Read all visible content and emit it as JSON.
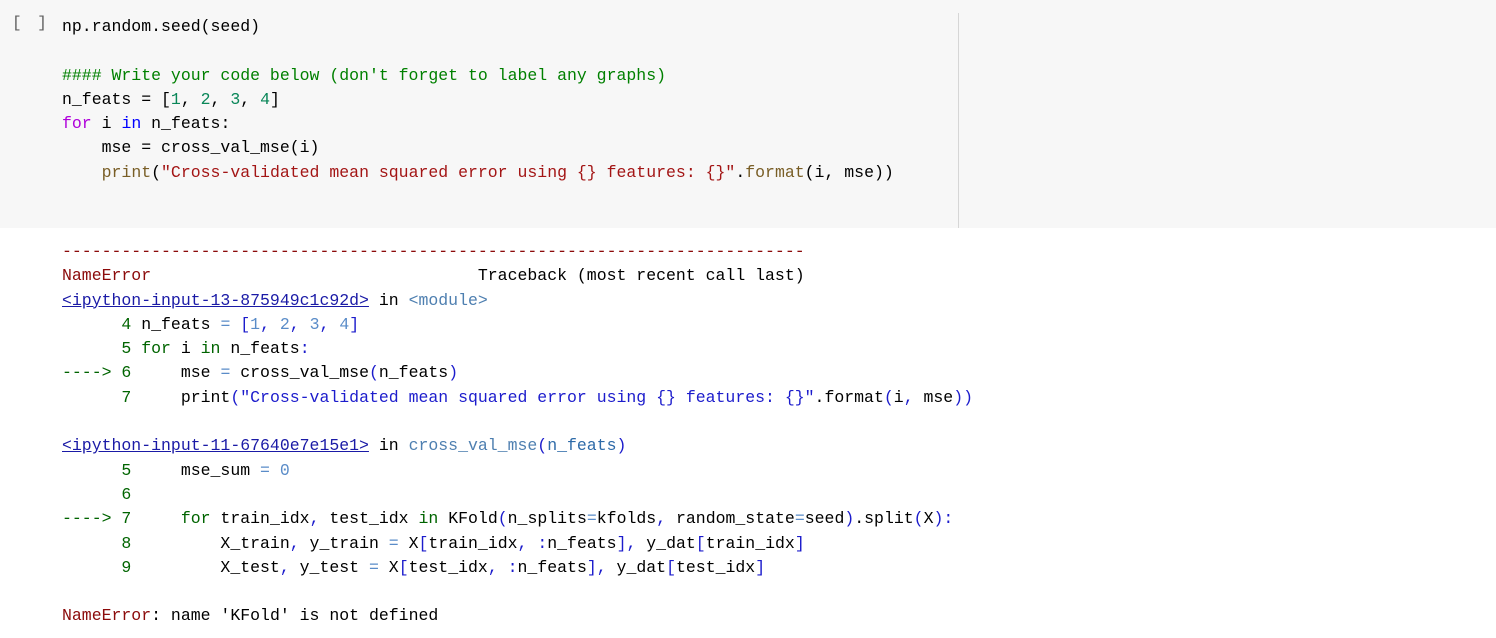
{
  "cell": {
    "execution_count": "[ ]",
    "code_lines": [
      [
        {
          "t": "np.random.seed(seed)",
          "c": ""
        }
      ],
      [
        {
          "t": "",
          "c": ""
        }
      ],
      [
        {
          "t": "#### Write your code below (don't forget to label any graphs)",
          "c": "c-comment"
        }
      ],
      [
        {
          "t": "n_feats = [",
          "c": ""
        },
        {
          "t": "1",
          "c": "c-num"
        },
        {
          "t": ", ",
          "c": ""
        },
        {
          "t": "2",
          "c": "c-num"
        },
        {
          "t": ", ",
          "c": ""
        },
        {
          "t": "3",
          "c": "c-num"
        },
        {
          "t": ", ",
          "c": ""
        },
        {
          "t": "4",
          "c": "c-num"
        },
        {
          "t": "]",
          "c": ""
        }
      ],
      [
        {
          "t": "for",
          "c": "c-kw"
        },
        {
          "t": " i ",
          "c": ""
        },
        {
          "t": "in",
          "c": "c-kw2"
        },
        {
          "t": " n_feats:",
          "c": ""
        }
      ],
      [
        {
          "t": "    mse = cross_val_mse(i)",
          "c": ""
        }
      ],
      [
        {
          "t": "    ",
          "c": ""
        },
        {
          "t": "print",
          "c": "c-fn"
        },
        {
          "t": "(",
          "c": ""
        },
        {
          "t": "\"Cross-validated mean squared error using {} features: {}\"",
          "c": "c-str"
        },
        {
          "t": ".",
          "c": ""
        },
        {
          "t": "format",
          "c": "c-fn"
        },
        {
          "t": "(i, mse))",
          "c": ""
        }
      ]
    ]
  },
  "output": {
    "lines": [
      [
        {
          "t": "---------------------------------------------------------------------------",
          "c": "t-red"
        }
      ],
      [
        {
          "t": "NameError",
          "c": "t-red"
        },
        {
          "t": "                                 Traceback (most recent call last)",
          "c": ""
        }
      ],
      [
        {
          "t": "<ipython-input-13-875949c1c92d>",
          "c": "t-link"
        },
        {
          "t": " in ",
          "c": ""
        },
        {
          "t": "<module>",
          "c": "t-gray-blue"
        }
      ],
      [
        {
          "t": "      4",
          "c": "t-green"
        },
        {
          "t": " n_feats ",
          "c": ""
        },
        {
          "t": "=",
          "c": "t-dim"
        },
        {
          "t": " ",
          "c": ""
        },
        {
          "t": "[",
          "c": "t-blue"
        },
        {
          "t": "1",
          "c": "t-dim"
        },
        {
          "t": ",",
          "c": "t-blue"
        },
        {
          "t": " ",
          "c": ""
        },
        {
          "t": "2",
          "c": "t-dim"
        },
        {
          "t": ",",
          "c": "t-blue"
        },
        {
          "t": " ",
          "c": ""
        },
        {
          "t": "3",
          "c": "t-dim"
        },
        {
          "t": ",",
          "c": "t-blue"
        },
        {
          "t": " ",
          "c": ""
        },
        {
          "t": "4",
          "c": "t-dim"
        },
        {
          "t": "]",
          "c": "t-blue"
        }
      ],
      [
        {
          "t": "      5",
          "c": "t-green"
        },
        {
          "t": " ",
          "c": ""
        },
        {
          "t": "for",
          "c": "t-green"
        },
        {
          "t": " i ",
          "c": ""
        },
        {
          "t": "in",
          "c": "t-green"
        },
        {
          "t": " n_feats",
          "c": ""
        },
        {
          "t": ":",
          "c": "t-blue"
        }
      ],
      [
        {
          "t": "----> 6",
          "c": "t-green"
        },
        {
          "t": "     mse ",
          "c": ""
        },
        {
          "t": "=",
          "c": "t-dim"
        },
        {
          "t": " cross_val_mse",
          "c": ""
        },
        {
          "t": "(",
          "c": "t-blue"
        },
        {
          "t": "n_feats",
          "c": ""
        },
        {
          "t": ")",
          "c": "t-blue"
        }
      ],
      [
        {
          "t": "      7",
          "c": "t-green"
        },
        {
          "t": "     print",
          "c": ""
        },
        {
          "t": "(\"Cross-validated mean squared error using {} features: {}\"",
          "c": "t-blue"
        },
        {
          "t": ".",
          "c": ""
        },
        {
          "t": "format",
          "c": ""
        },
        {
          "t": "(",
          "c": "t-blue"
        },
        {
          "t": "i",
          "c": ""
        },
        {
          "t": ",",
          "c": "t-blue"
        },
        {
          "t": " mse",
          "c": ""
        },
        {
          "t": "))",
          "c": "t-blue"
        }
      ],
      [
        {
          "t": "",
          "c": ""
        }
      ],
      [
        {
          "t": "<ipython-input-11-67640e7e15e1>",
          "c": "t-link"
        },
        {
          "t": " in ",
          "c": ""
        },
        {
          "t": "cross_val_mse",
          "c": "t-gray-blue"
        },
        {
          "t": "(",
          "c": "t-blue"
        },
        {
          "t": "n_feats",
          "c": "t-teal"
        },
        {
          "t": ")",
          "c": "t-blue"
        }
      ],
      [
        {
          "t": "      5",
          "c": "t-green"
        },
        {
          "t": "     mse_sum ",
          "c": ""
        },
        {
          "t": "=",
          "c": "t-dim"
        },
        {
          "t": " ",
          "c": ""
        },
        {
          "t": "0",
          "c": "t-dim"
        }
      ],
      [
        {
          "t": "      6",
          "c": "t-green"
        }
      ],
      [
        {
          "t": "----> 7",
          "c": "t-green"
        },
        {
          "t": "     for",
          "c": "t-green"
        },
        {
          "t": " train_idx",
          "c": ""
        },
        {
          "t": ",",
          "c": "t-blue"
        },
        {
          "t": " test_idx ",
          "c": ""
        },
        {
          "t": "in",
          "c": "t-green"
        },
        {
          "t": " KFold",
          "c": ""
        },
        {
          "t": "(",
          "c": "t-blue"
        },
        {
          "t": "n_splits",
          "c": ""
        },
        {
          "t": "=",
          "c": "t-dim"
        },
        {
          "t": "kfolds",
          "c": ""
        },
        {
          "t": ",",
          "c": "t-blue"
        },
        {
          "t": " random_state",
          "c": ""
        },
        {
          "t": "=",
          "c": "t-dim"
        },
        {
          "t": "seed",
          "c": ""
        },
        {
          "t": ")",
          "c": "t-blue"
        },
        {
          "t": ".",
          "c": ""
        },
        {
          "t": "split",
          "c": ""
        },
        {
          "t": "(",
          "c": "t-blue"
        },
        {
          "t": "X",
          "c": ""
        },
        {
          "t": "):",
          "c": "t-blue"
        }
      ],
      [
        {
          "t": "      8",
          "c": "t-green"
        },
        {
          "t": "         X_train",
          "c": ""
        },
        {
          "t": ",",
          "c": "t-blue"
        },
        {
          "t": " y_train ",
          "c": ""
        },
        {
          "t": "=",
          "c": "t-dim"
        },
        {
          "t": " X",
          "c": ""
        },
        {
          "t": "[",
          "c": "t-blue"
        },
        {
          "t": "train_idx",
          "c": ""
        },
        {
          "t": ",",
          "c": "t-blue"
        },
        {
          "t": " ",
          "c": ""
        },
        {
          "t": ":",
          "c": "t-blue"
        },
        {
          "t": "n_feats",
          "c": ""
        },
        {
          "t": "],",
          "c": "t-blue"
        },
        {
          "t": " y_dat",
          "c": ""
        },
        {
          "t": "[",
          "c": "t-blue"
        },
        {
          "t": "train_idx",
          "c": ""
        },
        {
          "t": "]",
          "c": "t-blue"
        }
      ],
      [
        {
          "t": "      9",
          "c": "t-green"
        },
        {
          "t": "         X_test",
          "c": ""
        },
        {
          "t": ",",
          "c": "t-blue"
        },
        {
          "t": " y_test ",
          "c": ""
        },
        {
          "t": "=",
          "c": "t-dim"
        },
        {
          "t": " X",
          "c": ""
        },
        {
          "t": "[",
          "c": "t-blue"
        },
        {
          "t": "test_idx",
          "c": ""
        },
        {
          "t": ",",
          "c": "t-blue"
        },
        {
          "t": " ",
          "c": ""
        },
        {
          "t": ":",
          "c": "t-blue"
        },
        {
          "t": "n_feats",
          "c": ""
        },
        {
          "t": "],",
          "c": "t-blue"
        },
        {
          "t": " y_dat",
          "c": ""
        },
        {
          "t": "[",
          "c": "t-blue"
        },
        {
          "t": "test_idx",
          "c": ""
        },
        {
          "t": "]",
          "c": "t-blue"
        }
      ],
      [
        {
          "t": "",
          "c": ""
        }
      ],
      [
        {
          "t": "NameError",
          "c": "t-red"
        },
        {
          "t": ": name 'KFold' is not defined",
          "c": ""
        }
      ]
    ]
  },
  "colors": {
    "cell_background": "#f7f7f7",
    "error_red": "#8b0a0a",
    "lineno_green": "#006400",
    "link_blue": "#1a1aa6"
  }
}
